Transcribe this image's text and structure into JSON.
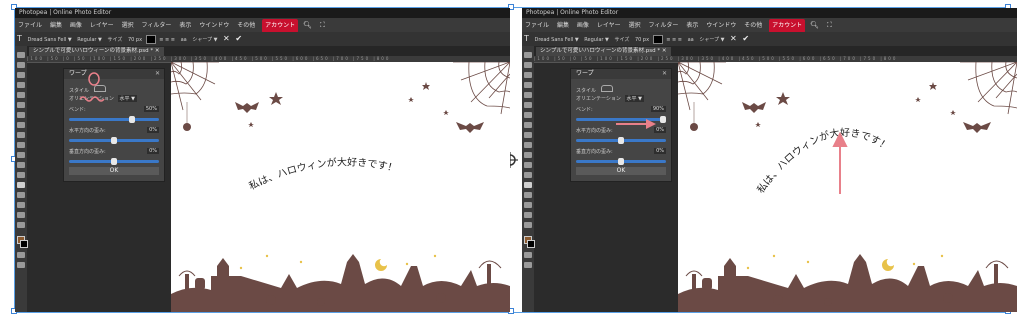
{
  "app_title": "Photopea | Online Photo Editor",
  "menu": [
    "ファイル",
    "編集",
    "画像",
    "レイヤー",
    "選択",
    "フィルター",
    "表示",
    "ウインドウ",
    "その他"
  ],
  "account_label": "アカウント",
  "options": {
    "font": "Dread Sans Fell ▼",
    "style": "Regular ▼",
    "size_label": "サイズ",
    "size": "70 px",
    "aa_label": "aa",
    "aa": "シャープ ▼"
  },
  "doc_tab": "シンプルで可愛いハロウィーンの背景素材.psd *",
  "dialog": {
    "title": "ワープ",
    "style_label": "スタイル",
    "orientation_label": "オリエンテーション",
    "orientation_value": "水平 ▼",
    "bend_label": "ベンド:",
    "h_distort_label": "水平方向の歪み:",
    "v_distort_label": "垂直方向の歪み:",
    "ok_label": "OK"
  },
  "panels": [
    {
      "bend": "50%",
      "h_distort": "0%",
      "v_distort": "0%"
    },
    {
      "bend": "90%",
      "h_distort": "0%",
      "v_distort": "0%"
    }
  ],
  "canvas_text": "私は、ハロウィンが大好きです！",
  "colors": {
    "accent": "#c8102e",
    "annotation": "#e8808a",
    "art": "#6b4a45",
    "star": "#e8c24a",
    "slider": "#3a78c8"
  }
}
